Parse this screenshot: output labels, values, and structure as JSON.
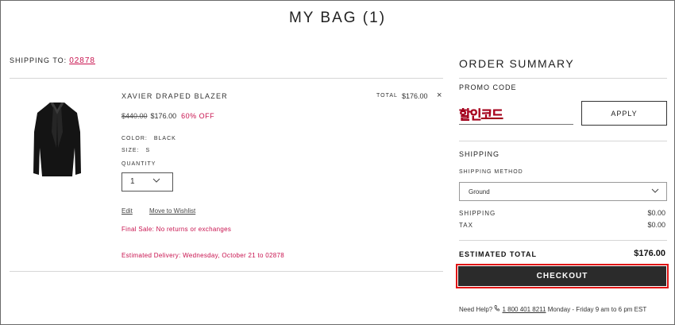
{
  "page": {
    "title": "MY BAG (1)"
  },
  "shipping_to": {
    "label": "SHIPPING TO:",
    "zip": "02878"
  },
  "product": {
    "name": "XAVIER DRAPED BLAZER",
    "total_label": "TOTAL",
    "total_value": "$176.00",
    "remove_label": "×",
    "original_price": "$440.00",
    "sale_price": "$176.00",
    "discount": "60% OFF",
    "color_label": "COLOR:",
    "color_value": "BLACK",
    "size_label": "SIZE:",
    "size_value": "S",
    "quantity_label": "QUANTITY",
    "quantity_value": "1",
    "edit_label": "Edit",
    "wishlist_label": "Move to Wishlist",
    "final_sale": "Final Sale: No returns or exchanges",
    "delivery": "Estimated Delivery: Wednesday, October 21 to 02878"
  },
  "summary": {
    "title": "ORDER SUMMARY",
    "promo_label": "PROMO CODE",
    "promo_value": "할인코드",
    "apply_label": "APPLY",
    "shipping_head": "SHIPPING",
    "shipping_method_label": "SHIPPING METHOD",
    "shipping_method_value": "Ground",
    "shipping_label": "SHIPPING",
    "shipping_value": "$0.00",
    "tax_label": "TAX",
    "tax_value": "$0.00",
    "estimated_label": "ESTIMATED TOTAL",
    "estimated_value": "$176.00",
    "checkout_label": "CHECKOUT",
    "help_label": "Need Help?",
    "help_phone": "1 800 401 8211",
    "help_hours": "Monday - Friday 9 am to 6 pm EST"
  },
  "colors": {
    "accent": "#c8124e",
    "checkout_bg": "#2b2b2b",
    "highlight": "#e01515"
  },
  "icons": {
    "remove": "close-icon",
    "dropdown": "chevron-down-icon",
    "phone": "phone-icon"
  }
}
